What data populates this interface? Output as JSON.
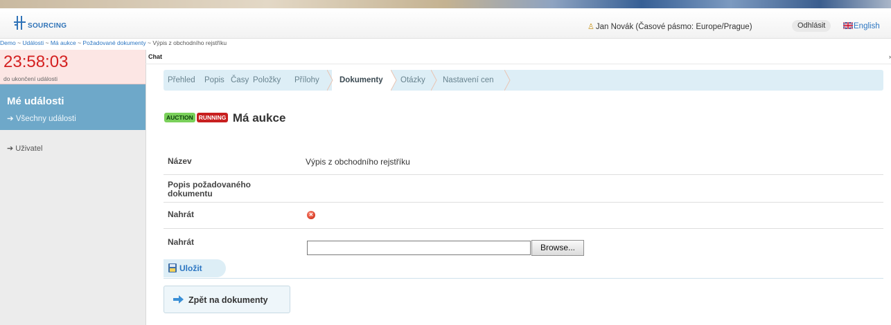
{
  "header": {
    "logo_text": "SOURCING",
    "user_label": "Jan Novák (Časové pásmo: Europe/Prague)",
    "logout_label": "Odhlásit",
    "language_label": "English"
  },
  "breadcrumb": {
    "items": [
      "Demo",
      "Události",
      "Má aukce",
      "Požadované dokumenty"
    ],
    "current": "Výpis z obchodního rejstříku",
    "separator": "~"
  },
  "sidebar": {
    "timer": "23:58:03",
    "timer_caption": "do ukončení události",
    "section_title": "Mé události",
    "section_link": "Všechny události",
    "user_link": "Uživatel"
  },
  "chat": {
    "label": "Chat"
  },
  "tabs": [
    {
      "label": "Přehled"
    },
    {
      "label": "Popis"
    },
    {
      "label": "Časy"
    },
    {
      "label": "Položky"
    },
    {
      "label": "Přílohy"
    },
    {
      "label": "Dokumenty",
      "active": true
    },
    {
      "label": "Otázky"
    },
    {
      "label": "Nastavení cen"
    }
  ],
  "event": {
    "badge_type": "AUCTION",
    "badge_status": "RUNNING",
    "title": "Má aukce"
  },
  "form": {
    "name_label": "Název",
    "name_value": "Výpis z obchodního rejstříku",
    "description_label": "Popis požadovaného dokumentu",
    "description_value": "",
    "upload_label": "Nahrát",
    "upload_label_2": "Nahrát",
    "browse_label": "Browse..."
  },
  "actions": {
    "save_label": "Uložit",
    "back_label": "Zpět na dokumenty"
  },
  "colors": {
    "accent": "#2c76c2",
    "sidebar_active": "#6ea8c9",
    "timer_red": "#d42020",
    "tab_bg": "#ddeef6"
  }
}
